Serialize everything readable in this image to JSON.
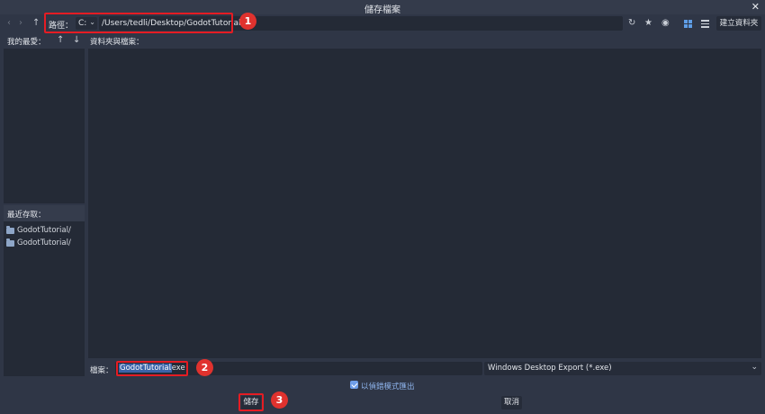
{
  "window": {
    "title": "儲存檔案",
    "close_glyph": "✕"
  },
  "toolbar": {
    "path_label": "路徑：",
    "drive": "C:",
    "path_value": "/Users/tedli/Desktop/GodotTutorial",
    "create_folder_label": "建立資料夾"
  },
  "favorites": {
    "heading": "我的最愛："
  },
  "recent": {
    "heading": "最近存取：",
    "items": [
      "GodotTutorial/",
      "GodotTutorial/"
    ]
  },
  "files": {
    "heading": "資料夾與檔案："
  },
  "save_row": {
    "file_label": "檔案：",
    "filename_selected": "GodotTutorial",
    "filename_extension": ".exe",
    "filter": "Windows Desktop Export (*.exe)"
  },
  "options": {
    "debug_export_label": "以偵錯模式匯出",
    "debug_export_checked": true
  },
  "actions": {
    "save_label": "儲存",
    "cancel_label": "取消"
  },
  "annotations": {
    "step1": "1",
    "step2": "2",
    "step3": "3"
  },
  "icons": [
    "back-icon",
    "forward-icon",
    "up-icon",
    "refresh-icon",
    "star-icon",
    "eye-icon",
    "grid-view-icon",
    "list-view-icon",
    "move-up-icon",
    "move-down-icon",
    "folder-icon",
    "chevron-down-icon",
    "close-icon",
    "checkbox-icon"
  ],
  "colors": {
    "accent": "#6f9ee8",
    "highlight": "#e51c23",
    "selection": "#3b64a8",
    "background": "#2f3646",
    "panel": "#242a36"
  }
}
